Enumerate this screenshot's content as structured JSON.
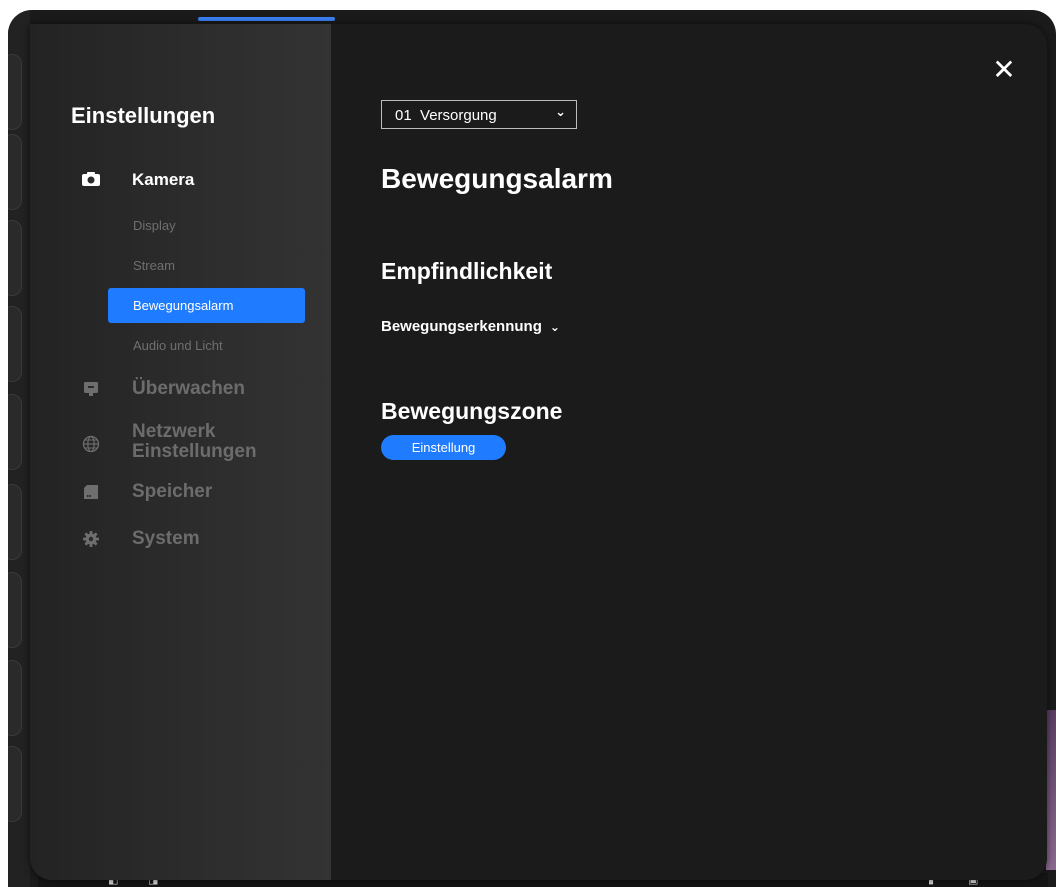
{
  "sidebar": {
    "title": "Einstellungen",
    "sections": [
      {
        "icon": "camera-icon",
        "label": "Kamera",
        "active": true
      },
      {
        "icon": "monitor-icon",
        "label": "Überwachen",
        "active": false
      },
      {
        "icon": "globe-icon",
        "label_line1": "Netzwerk",
        "label_line2": "Einstellungen",
        "active": false
      },
      {
        "icon": "storage-icon",
        "label": "Speicher",
        "active": false
      },
      {
        "icon": "gear-icon",
        "label": "System",
        "active": false
      }
    ],
    "camera_items": [
      {
        "label": "Display",
        "selected": false
      },
      {
        "label": "Stream",
        "selected": false
      },
      {
        "label": "Bewegungsalarm",
        "selected": true
      },
      {
        "label": "Audio und Licht",
        "selected": false
      }
    ]
  },
  "content": {
    "channel_select": {
      "value": "01  Versorgung"
    },
    "page_title": "Bewegungsalarm",
    "sensitivity": {
      "heading": "Empfindlichkeit",
      "dropdown_label": "Bewegungserkennung"
    },
    "zone": {
      "heading": "Bewegungszone",
      "button_label": "Einstellung"
    }
  },
  "colors": {
    "accent": "#1f7bff",
    "background": "#1b1b1b",
    "sidebar": "#2d2d2d",
    "muted_text": "#6c6c6c"
  }
}
